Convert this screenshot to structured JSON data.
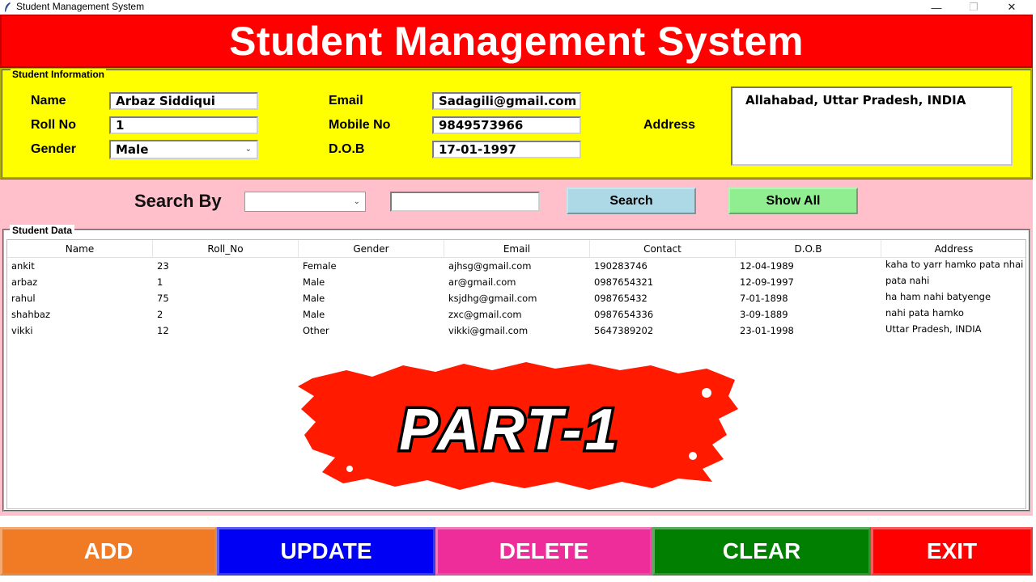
{
  "window": {
    "title": "Student Management System",
    "minimize": "—",
    "maximize": "❐",
    "close": "✕"
  },
  "header": {
    "title": "Student Management System",
    "color": "#ff0000"
  },
  "student_info": {
    "legend": "Student Information",
    "name_label": "Name",
    "name_value": "Arbaz Siddiqui",
    "roll_label": "Roll No",
    "roll_value": "1",
    "gender_label": "Gender",
    "gender_value": "Male",
    "email_label": "Email",
    "email_value": "Sadagili@gmail.com",
    "mobile_label": "Mobile No",
    "mobile_value": "9849573966",
    "dob_label": "D.O.B",
    "dob_value": "17-01-1997",
    "address_label": "Address",
    "address_value": "Allahabad, Uttar Pradesh, INDIA"
  },
  "search": {
    "label": "Search By",
    "select_value": "",
    "input_value": "",
    "search_button": "Search",
    "show_all_button": "Show All"
  },
  "student_data": {
    "legend": "Student Data",
    "columns": [
      "Name",
      "Roll_No",
      "Gender",
      "Email",
      "Contact",
      "D.O.B",
      "Address"
    ],
    "rows": [
      [
        "ankit",
        "23",
        "Female",
        "ajhsg@gmail.com",
        "190283746",
        "12-04-1989",
        "kaha to yarr hamko pata nhai"
      ],
      [
        "arbaz",
        "1",
        "Male",
        "ar@gmail.com",
        "0987654321",
        "12-09-1997",
        "pata nahi"
      ],
      [
        "rahul",
        "75",
        "Male",
        "ksjdhg@gmail.com",
        "098765432",
        "7-01-1898",
        "ha ham nahi batyenge"
      ],
      [
        "shahbaz",
        "2",
        "Male",
        "zxc@gmail.com",
        "0987654336",
        "3-09-1889",
        "nahi pata hamko"
      ],
      [
        "vikki",
        "12",
        "Other",
        "vikki@gmail.com",
        "5647389202",
        "23-01-1998",
        "Uttar Pradesh, INDIA"
      ]
    ]
  },
  "overlay": {
    "text": "PART-1",
    "color": "#ff1a00"
  },
  "buttons": {
    "add": "ADD",
    "update": "UPDATE",
    "delete": "DELETE",
    "clear": "CLEAR",
    "exit": "EXIT"
  }
}
